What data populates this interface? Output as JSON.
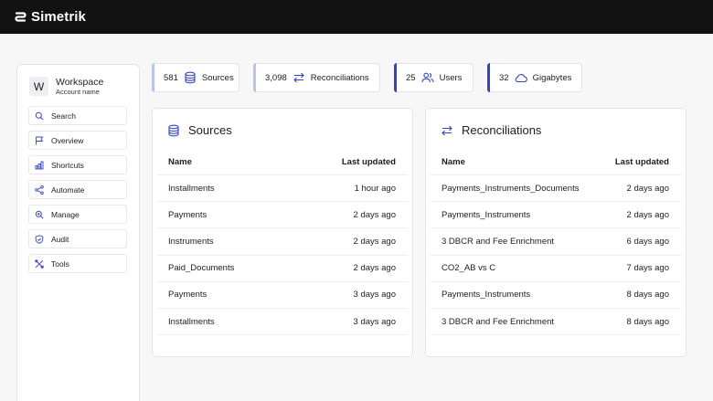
{
  "app": {
    "name": "Simetrik"
  },
  "workspace": {
    "initial": "W",
    "name": "Workspace",
    "account": "Account name"
  },
  "nav": [
    {
      "label": "Search",
      "icon": "search-icon"
    },
    {
      "label": "Overview",
      "icon": "flag-icon"
    },
    {
      "label": "Shortcuts",
      "icon": "bar-chart-icon"
    },
    {
      "label": "Automate",
      "icon": "share-icon"
    },
    {
      "label": "Manage",
      "icon": "zoom-in-icon"
    },
    {
      "label": "Audit",
      "icon": "shield-icon"
    },
    {
      "label": "Tools",
      "icon": "tools-icon"
    }
  ],
  "stats": [
    {
      "value": "581",
      "label": "Sources",
      "icon": "database-icon",
      "accent": "#b8c4ee"
    },
    {
      "value": "3,098",
      "label": "Reconciliations",
      "icon": "arrows-exchange-icon",
      "accent": "#b8c4ee"
    },
    {
      "value": "25",
      "label": "Users",
      "icon": "users-icon",
      "accent": "#2f45c9"
    },
    {
      "value": "32",
      "label": "Gigabytes",
      "icon": "cloud-icon",
      "accent": "#2f45c9"
    }
  ],
  "sources": {
    "title": "Sources",
    "col_name": "Name",
    "col_updated": "Last updated",
    "rows": [
      {
        "name": "Installments",
        "updated": "1 hour ago"
      },
      {
        "name": "Payments",
        "updated": "2 days ago"
      },
      {
        "name": "Instruments",
        "updated": "2 days ago"
      },
      {
        "name": "Paid_Documents",
        "updated": "2 days ago"
      },
      {
        "name": "Payments",
        "updated": "3 days ago"
      },
      {
        "name": "Installments",
        "updated": "3 days ago"
      }
    ]
  },
  "reconciliations": {
    "title": "Reconciliations",
    "col_name": "Name",
    "col_updated": "Last updated",
    "rows": [
      {
        "name": "Payments_Instruments_Documents",
        "updated": "2 days ago"
      },
      {
        "name": "Payments_Instruments",
        "updated": "2 days ago"
      },
      {
        "name": "3 DBCR and Fee Enrichment",
        "updated": "6 days ago"
      },
      {
        "name": "CO2_AB vs C",
        "updated": "7 days ago"
      },
      {
        "name": "Payments_Instruments",
        "updated": "8 days ago"
      },
      {
        "name": "3 DBCR and Fee Enrichment",
        "updated": "8 days ago"
      }
    ]
  },
  "colors": {
    "icon_blue": "#3344c7",
    "topbar": "#121212"
  }
}
